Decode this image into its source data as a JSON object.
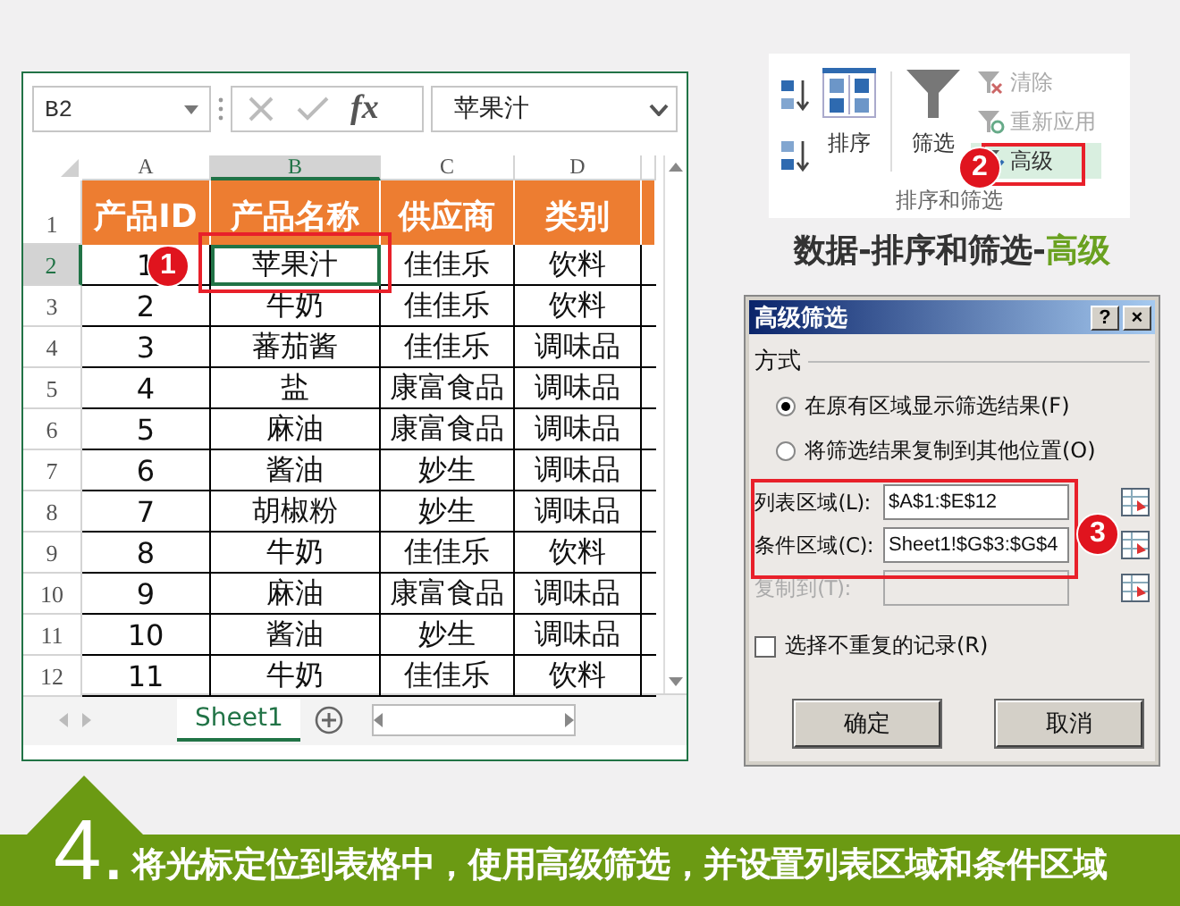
{
  "spreadsheet": {
    "name_box": "B2",
    "function_label": "fx",
    "formula_value": "苹果汁",
    "callout": "1",
    "columns": [
      {
        "label": "A",
        "selected": false
      },
      {
        "label": "B",
        "selected": true
      },
      {
        "label": "C",
        "selected": false
      },
      {
        "label": "D",
        "selected": false
      }
    ],
    "header_row": {
      "number": "1",
      "cells": [
        "产品ID",
        "产品名称",
        "供应商",
        "类别"
      ]
    },
    "rows": [
      {
        "number": "2",
        "selected": true,
        "cells": [
          "1",
          "苹果汁",
          "佳佳乐",
          "饮料"
        ]
      },
      {
        "number": "3",
        "selected": false,
        "cells": [
          "2",
          "牛奶",
          "佳佳乐",
          "饮料"
        ]
      },
      {
        "number": "4",
        "selected": false,
        "cells": [
          "3",
          "蕃茄酱",
          "佳佳乐",
          "调味品"
        ]
      },
      {
        "number": "5",
        "selected": false,
        "cells": [
          "4",
          "盐",
          "康富食品",
          "调味品"
        ]
      },
      {
        "number": "6",
        "selected": false,
        "cells": [
          "5",
          "麻油",
          "康富食品",
          "调味品"
        ]
      },
      {
        "number": "7",
        "selected": false,
        "cells": [
          "6",
          "酱油",
          "妙生",
          "调味品"
        ]
      },
      {
        "number": "8",
        "selected": false,
        "cells": [
          "7",
          "胡椒粉",
          "妙生",
          "调味品"
        ]
      },
      {
        "number": "9",
        "selected": false,
        "cells": [
          "8",
          "牛奶",
          "佳佳乐",
          "饮料"
        ]
      },
      {
        "number": "10",
        "selected": false,
        "cells": [
          "9",
          "麻油",
          "康富食品",
          "调味品"
        ]
      },
      {
        "number": "11",
        "selected": false,
        "cells": [
          "10",
          "酱油",
          "妙生",
          "调味品"
        ]
      },
      {
        "number": "12",
        "selected": false,
        "cells": [
          "11",
          "牛奶",
          "佳佳乐",
          "饮料"
        ]
      }
    ],
    "sheet_tabs": [
      {
        "label": "Sheet1",
        "selected": true
      }
    ]
  },
  "ribbon": {
    "sort_label": "排序",
    "filter_label": "筛选",
    "callout": "2",
    "commands": [
      {
        "label": "清除",
        "disabled": true,
        "highlighted": false
      },
      {
        "label": "重新应用",
        "disabled": true,
        "highlighted": false
      },
      {
        "label": "高级",
        "disabled": false,
        "highlighted": true
      }
    ],
    "group_label": "排序和筛选"
  },
  "caption": {
    "lead": "数据-排序和筛选-",
    "highlight": "高级"
  },
  "dialog": {
    "title": "高级筛选",
    "help": "?",
    "close": "×",
    "section": "方式",
    "callout": "3",
    "options": [
      {
        "label": "在原有区域显示筛选结果(F)",
        "selected": true
      },
      {
        "label": "将筛选结果复制到其他位置(O)",
        "selected": false
      }
    ],
    "fields": [
      {
        "label": "列表区域(L):",
        "value": "$A$1:$E$12",
        "disabled": false
      },
      {
        "label": "条件区域(C):",
        "value": "Sheet1!$G$3:$G$4",
        "disabled": false
      },
      {
        "label": "复制到(T):",
        "disabled": true
      }
    ],
    "checkbox": {
      "label": "选择不重复的记录(R)",
      "checked": false
    },
    "buttons": [
      "确定",
      "取消"
    ]
  },
  "banner": {
    "number": "4.",
    "text": "将光标定位到表格中，使用高级筛选，并设置列表区域和条件区域"
  }
}
